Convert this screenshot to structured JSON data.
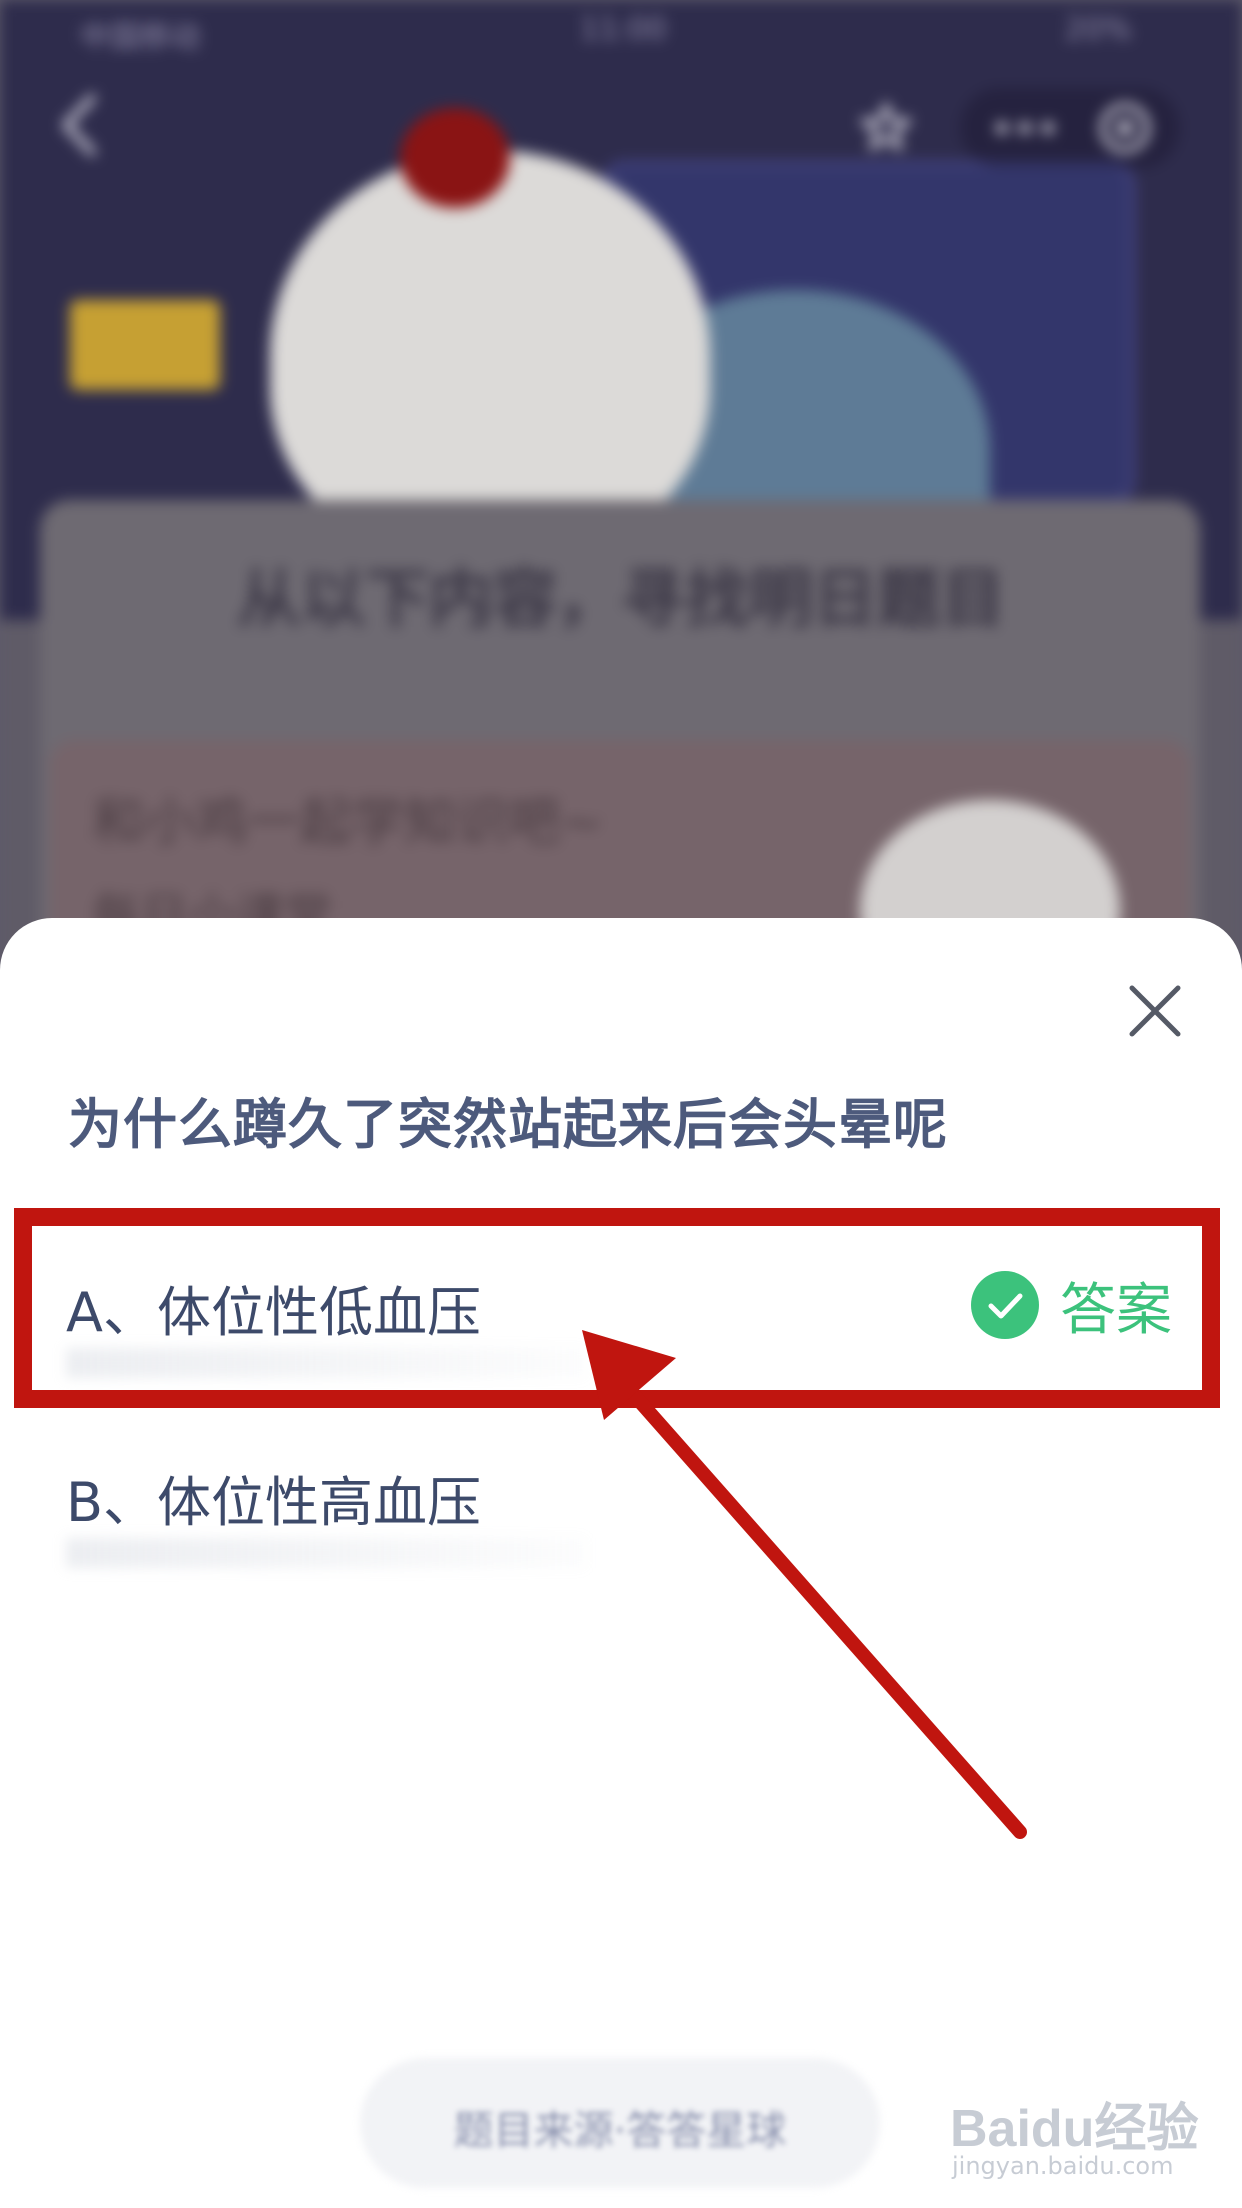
{
  "status_bar": {
    "carrier": "中国移动",
    "time": "11:00",
    "battery": "20%"
  },
  "background": {
    "card_title": "从以下内容，寻找明日题目",
    "card_heading": "和小鸡一起学知识吧~",
    "card_subheading": "每日小课堂",
    "bottom_button": "题目来源·答答星球"
  },
  "dialog": {
    "question": "为什么蹲久了突然站起来后会头晕呢",
    "options": [
      {
        "label": "A、体位性低血压",
        "answer_tag": "答案",
        "is_answer": true
      },
      {
        "label": "B、体位性高血压"
      }
    ]
  },
  "annotation": {
    "color": "#c0150f"
  },
  "watermark": {
    "logo": "Baidu经验",
    "url": "jingyan.baidu.com"
  },
  "colors": {
    "question": "#4d5a7c",
    "option_text": "#3d4a6a",
    "answer_green": "#3cc27c"
  }
}
